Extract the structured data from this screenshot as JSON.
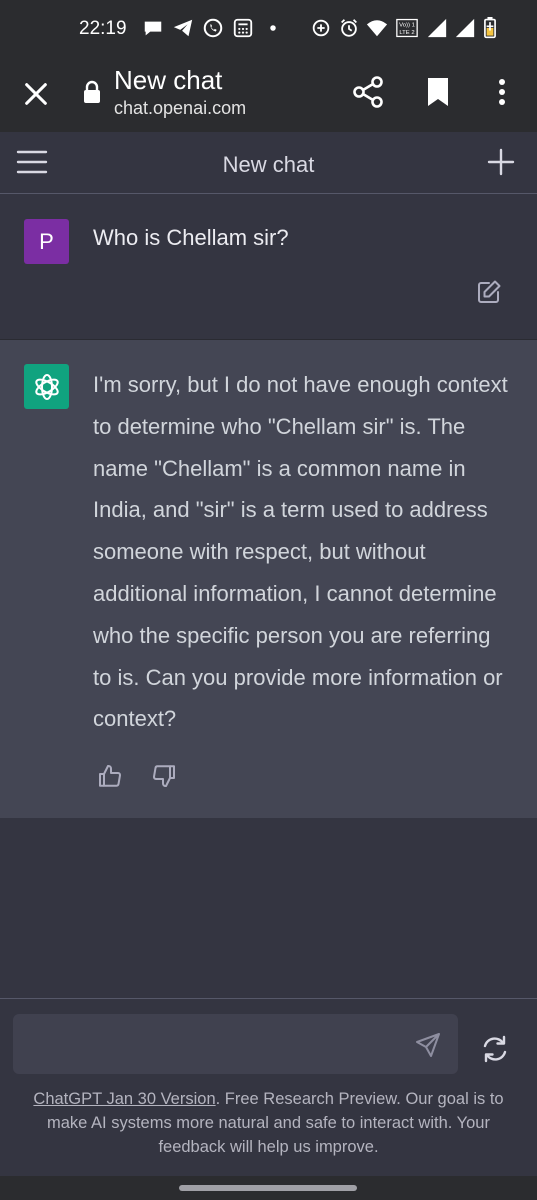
{
  "status_bar": {
    "time": "22:19",
    "lte_label_top": "Vo)) 1",
    "lte_label_bottom": "LTE 2",
    "icons_left": [
      "message-icon",
      "telegram-icon",
      "whatsapp-icon",
      "calculator-icon",
      "dot-icon"
    ],
    "icons_right": [
      "data-saver-icon",
      "alarm-icon",
      "wifi-icon",
      "lte-icon",
      "signal-1-icon",
      "signal-2-icon",
      "battery-charging-icon"
    ]
  },
  "browser": {
    "title": "New chat",
    "url": "chat.openai.com"
  },
  "header": {
    "title": "New chat"
  },
  "user_message": {
    "avatar_letter": "P",
    "text": "Who is Chellam sir?",
    "avatar_color": "#7b2ea3"
  },
  "assistant_message": {
    "text": "I'm sorry, but I do not have enough context to determine who \"Chellam sir\" is. The name \"Chellam\" is a common name in India, and \"sir\" is a term used to address someone with respect, but without additional information, I cannot determine who the specific person you are referring to is. Can you provide more information or context?",
    "avatar_color": "#10a37f"
  },
  "input": {
    "placeholder": "",
    "value": ""
  },
  "footer": {
    "link_text": "ChatGPT Jan 30 Version",
    "rest_text": ". Free Research Preview. Our goal is to make AI systems more natural and safe to interact with. Your feedback will help us improve."
  },
  "colors": {
    "background": "#343541",
    "assistant_background": "#444654",
    "bars": "#2b2c2f"
  }
}
